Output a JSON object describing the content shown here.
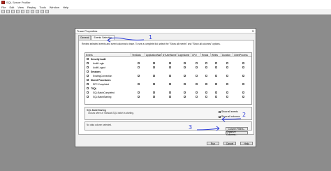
{
  "window": {
    "title": "SQL Server Profiler"
  },
  "menu": [
    "File",
    "Edit",
    "View",
    "Replay",
    "Tools",
    "Window",
    "Help"
  ],
  "dialog": {
    "title": "Trace Properties",
    "tabs": [
      "General",
      "Events Selection"
    ],
    "instructions": "Review selected events and event columns to trace. To see a complete list, select the \"Show all events\" and \"Show all columns\" options.",
    "grid": {
      "columns": [
        "Events",
        "TextData",
        "ApplicationName",
        "NTUserName",
        "LoginName",
        "CPU",
        "Reads",
        "Writes",
        "Duration",
        "ClientProcess"
      ],
      "rows": [
        {
          "label": "Security Audit",
          "category": true
        },
        {
          "label": "Audit Login",
          "category": false,
          "checks": [
            1,
            1,
            1,
            1,
            0,
            0,
            0,
            0,
            1
          ]
        },
        {
          "label": "Audit Logout",
          "category": false,
          "checks": [
            0,
            1,
            1,
            1,
            1,
            1,
            1,
            1,
            1
          ]
        },
        {
          "label": "Sessions",
          "category": true
        },
        {
          "label": "ExistingConnection",
          "category": false,
          "checks": [
            1,
            1,
            1,
            1,
            0,
            0,
            0,
            0,
            1
          ]
        },
        {
          "label": "Stored Procedures",
          "category": true
        },
        {
          "label": "RPC:Completed",
          "category": false,
          "checks": [
            1,
            1,
            1,
            1,
            1,
            1,
            1,
            1,
            1
          ]
        },
        {
          "label": "TSQL",
          "category": true
        },
        {
          "label": "SQL:BatchCompleted",
          "category": false,
          "checks": [
            1,
            1,
            1,
            1,
            1,
            1,
            1,
            1,
            1
          ]
        },
        {
          "label": "SQL:BatchStarting",
          "category": false,
          "checks": [
            1,
            1,
            1,
            1,
            0,
            0,
            0,
            0,
            1
          ]
        }
      ]
    },
    "description": {
      "title": "SQL:BatchStarting",
      "text": "Occurs when a Transact-SQL batch is starting."
    },
    "options": {
      "show_all_events": "Show all events",
      "show_all_columns": "Show all columns",
      "show_all_columns_checked": true
    },
    "column_selected_text": "No data column selected.",
    "buttons": {
      "column_filters": "Column Filters...",
      "organize_columns": "Organize Columns...",
      "run": "Run",
      "cancel": "Cancel",
      "help": "Help"
    }
  },
  "annotations": {
    "one": "1",
    "two": "2",
    "three": "3"
  },
  "colors": {
    "annotation": "#2b3bd8"
  }
}
